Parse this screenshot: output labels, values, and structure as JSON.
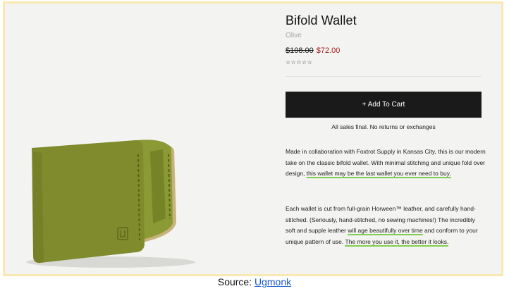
{
  "product": {
    "title": "Bifold Wallet",
    "variant": "Olive",
    "old_price": "$108.00",
    "new_price": "$72.00",
    "rating_stars": "☆☆☆☆☆",
    "add_to_cart_label": "+ Add To Cart",
    "sales_note": "All sales final. No returns or exchanges"
  },
  "description": {
    "p1_a": "Made in collaboration with Foxtrot Supply in Kansas City, this is our modern take on the classic bifold wallet. With minimal stitching and unique fold over design, ",
    "p1_hl": "this wallet may be the last wallet you ever need to buy.",
    "p2_a": "Each wallet is cut from full-grain Horween™ leather, and carefully hand-stitched. (Seriously, hand-stitched, no sewing machines!) The incredibly soft and supple leather ",
    "p2_hl1": "will age beautifully over time",
    "p2_b": " and conform to your unique pattern of use. ",
    "p2_hl2": "The more you use it, the better it looks."
  },
  "caption": {
    "prefix": "Source: ",
    "link": "Ugmonk"
  },
  "colors": {
    "frame": "#fbe7b0",
    "leather": "#7d8a2d",
    "sale": "#9b2222",
    "highlight": "#7fcf4e",
    "button": "#1a1a1a"
  }
}
